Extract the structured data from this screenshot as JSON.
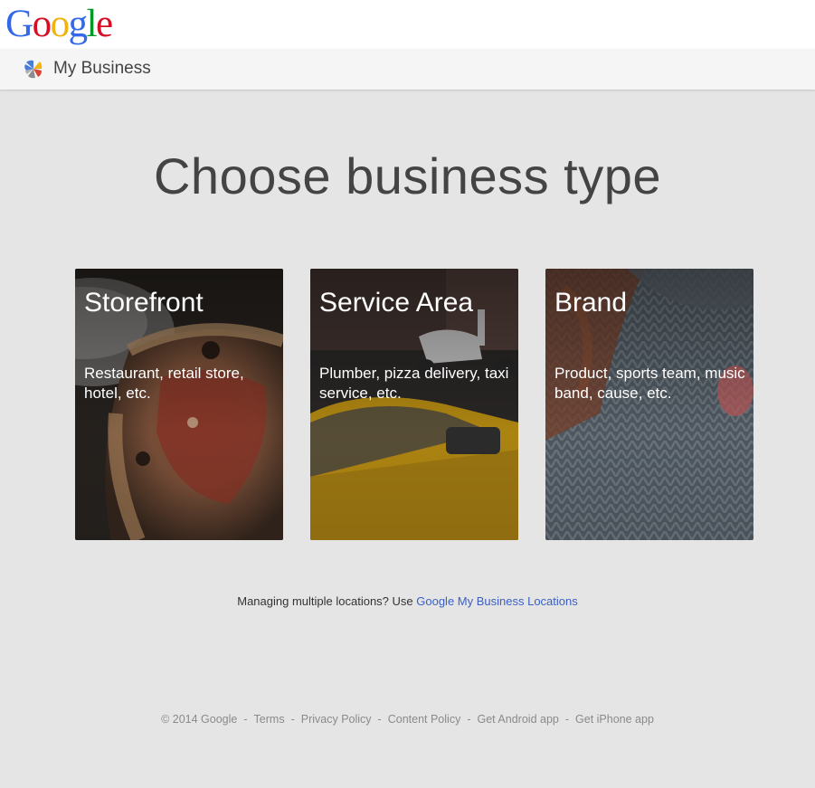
{
  "header": {
    "logo_letters": [
      {
        "ch": "G",
        "color": "#3369e8"
      },
      {
        "ch": "o",
        "color": "#d50f25"
      },
      {
        "ch": "o",
        "color": "#eeb211"
      },
      {
        "ch": "g",
        "color": "#3369e8"
      },
      {
        "ch": "l",
        "color": "#009925"
      },
      {
        "ch": "e",
        "color": "#d50f25"
      }
    ],
    "product_name": "My Business",
    "product_icon": "my-business-icon"
  },
  "main": {
    "title": "Choose business type",
    "cards": [
      {
        "title": "Storefront",
        "description": "Restaurant, retail store, hotel, etc.",
        "image": "pizza-photo"
      },
      {
        "title": "Service Area",
        "description": "Plumber, pizza delivery, taxi service, etc.",
        "image": "scooter-taxi-photo"
      },
      {
        "title": "Brand",
        "description": "Product, sports team, music band, cause, etc.",
        "image": "knit-sweater-photo"
      }
    ],
    "multi_text": "Managing multiple locations? Use ",
    "multi_link": "Google My Business Locations"
  },
  "footer": {
    "copyright": "© 2014 Google",
    "separator": "-",
    "links": [
      "Terms",
      "Privacy Policy",
      "Content Policy",
      "Get Android app",
      "Get iPhone app"
    ]
  }
}
